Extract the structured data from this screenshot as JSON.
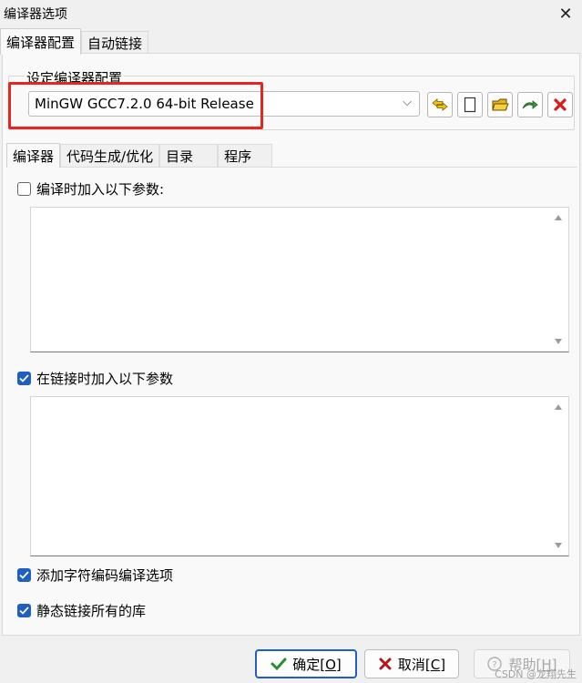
{
  "window": {
    "title": "编译器选项",
    "close_glyph": "✕"
  },
  "top_tabs": [
    "编译器配置",
    "自动链接"
  ],
  "group": {
    "title": "设定编译器配置",
    "selected_profile": "MinGW GCC7.2.0 64-bit Release",
    "dropdown_glyph": "⌵"
  },
  "toolbar_icons": [
    "swap-icon",
    "new-profile-icon",
    "folder-open-icon",
    "rename-icon",
    "delete-icon"
  ],
  "inner_tabs": [
    "编译器",
    "代码生成/优化",
    "目录",
    "程序"
  ],
  "compiler": {
    "compile_args_label": "编译时加入以下参数:",
    "compile_args_checked": false,
    "compile_args_value": "",
    "link_args_label": "在链接时加入以下参数",
    "link_args_checked": true,
    "link_args_value": "",
    "charset_label": "添加字符编码编译选项",
    "charset_checked": true,
    "static_label": "静态链接所有的库",
    "static_checked": true
  },
  "buttons": {
    "ok_label": "确定",
    "ok_key": "O",
    "cancel_label": "取消",
    "cancel_key": "C",
    "help_label": "帮助",
    "help_key": "H"
  },
  "watermark": "CSDN @龙翔先生",
  "colors": {
    "accent": "#1e5fc0",
    "highlight": "#e3261f"
  }
}
